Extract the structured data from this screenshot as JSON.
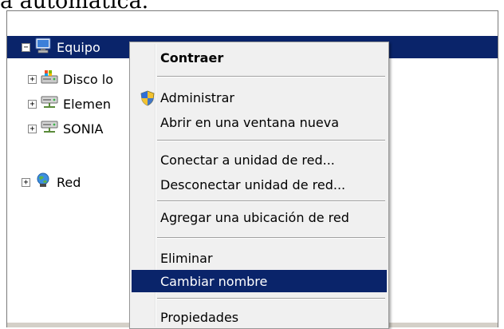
{
  "caption": "a automática.",
  "tree": {
    "root": {
      "label": "Equipo",
      "expander": "−",
      "icon": "computer-icon"
    },
    "children": [
      {
        "label": "Disco lo",
        "expander": "+",
        "icon": "local-disk-icon"
      },
      {
        "label": "Elemen",
        "expander": "+",
        "icon": "network-drive-icon"
      },
      {
        "label": "SONIA",
        "expander": "+",
        "icon": "network-drive-icon"
      }
    ],
    "network": {
      "label": "Red",
      "expander": "+",
      "icon": "network-globe-icon"
    }
  },
  "context_menu": {
    "collapse": "Contraer",
    "manage": "Administrar",
    "open_new_window": "Abrir en una ventana nueva",
    "map_network_drive": "Conectar a unidad de red...",
    "disconnect_network_drive": "Desconectar unidad de red...",
    "add_network_location": "Agregar una ubicación de red",
    "delete": "Eliminar",
    "rename": "Cambiar nombre",
    "properties": "Propiedades",
    "manage_icon": "uac-shield-icon"
  },
  "colors": {
    "selection": "#0a246a",
    "menu_bg": "#f0f0f0"
  }
}
